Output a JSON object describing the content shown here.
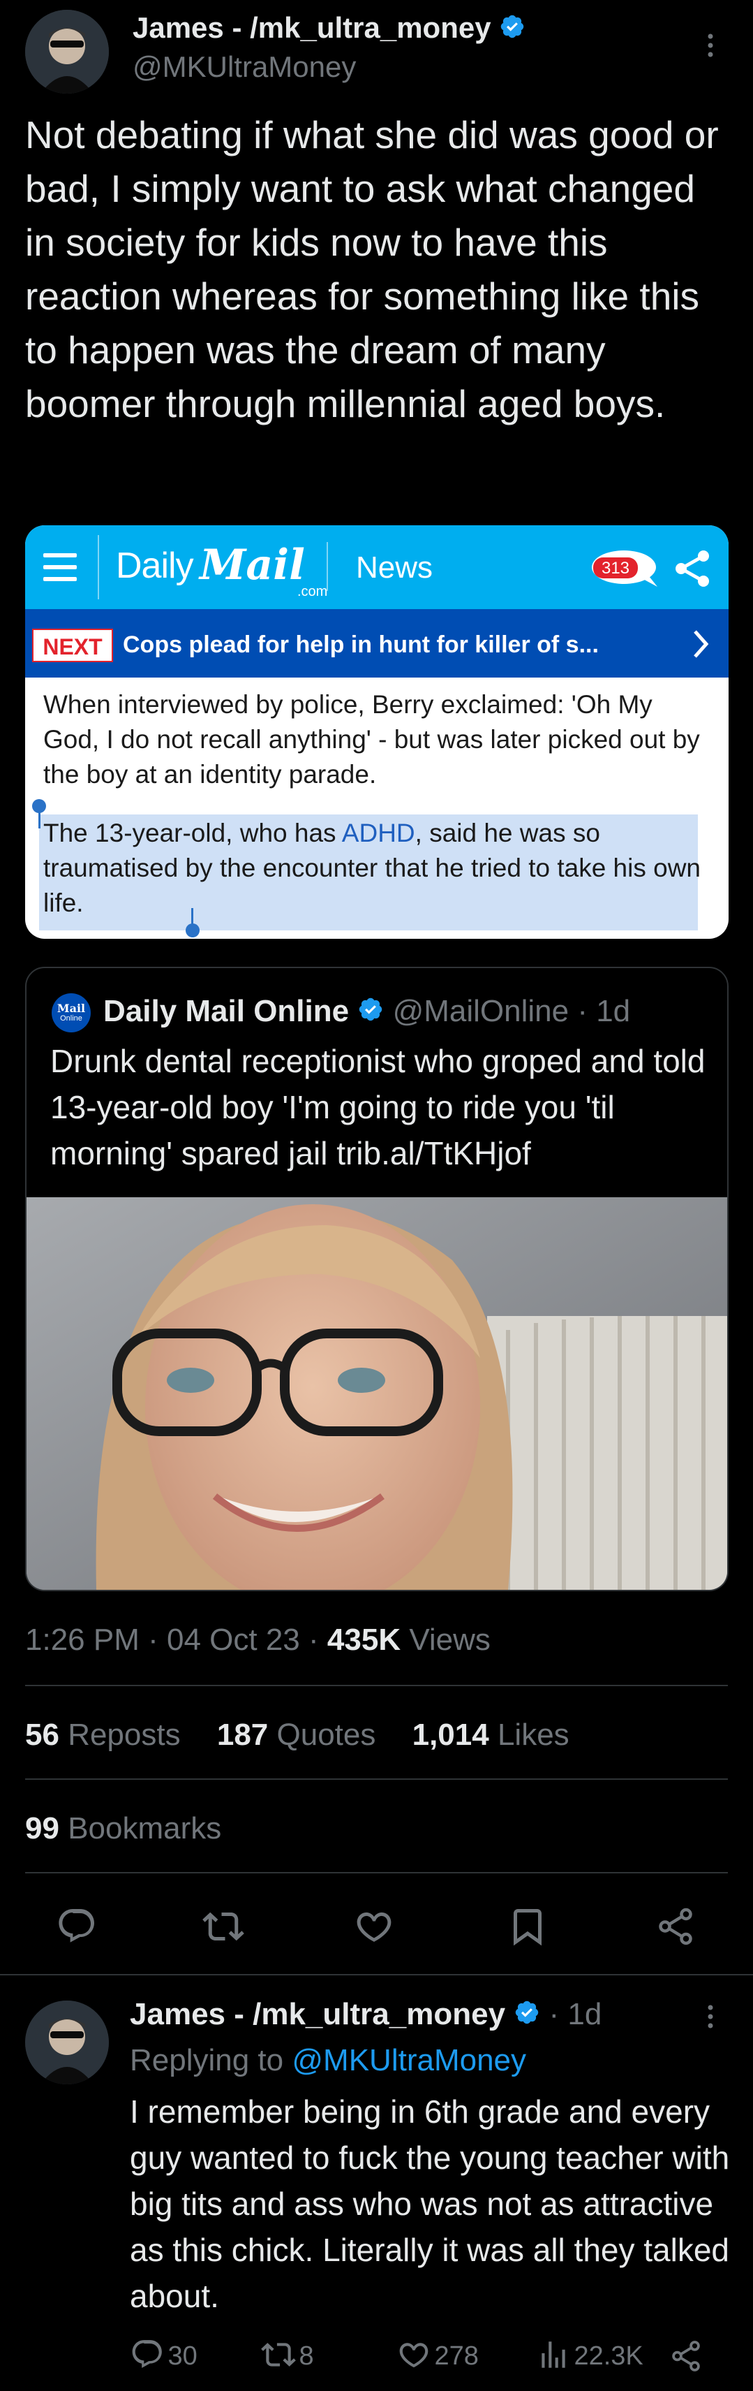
{
  "main_tweet": {
    "author_name": "James - /mk_ultra_money",
    "author_handle": "@MKUltraMoney",
    "text": "Not debating if what she did was good or bad, I simply want to ask what changed in society for kids now to have this reaction whereas for something like this to happen was the dream of many boomer through millennial aged boys."
  },
  "screenshot": {
    "brand_daily": "Daily",
    "brand_mail": "Mail",
    "brand_com": ".com",
    "section": "News",
    "comment_count": "313",
    "next_label": "NEXT",
    "next_headline": "Cops plead for help in hunt for killer of s...",
    "para1": "When interviewed by police, Berry exclaimed: 'Oh My God, I do not recall anything' - but was later picked out by the boy at an identity parade.",
    "para2_a": "The 13-year-old, who has ",
    "para2_link": "ADHD",
    "para2_b": ", said he was so traumatised by the encounter that he tried to take his own life."
  },
  "quoted": {
    "avatar_text_1": "Mail",
    "avatar_text_2": "Online",
    "author_name": "Daily Mail Online",
    "author_handle": "@MailOnline",
    "time": "· 1d",
    "text": "Drunk dental receptionist who groped and told 13-year-old boy 'I'm going to ride you 'til morning' spared jail trib.al/TtKHjof"
  },
  "meta": {
    "time": "1:26 PM",
    "sep1": "·",
    "date": "04 Oct 23",
    "sep2": "·",
    "views_count": "435K",
    "views_label": "Views"
  },
  "stats": {
    "reposts_count": "56",
    "reposts_label": "Reposts",
    "quotes_count": "187",
    "quotes_label": "Quotes",
    "likes_count": "1,014",
    "likes_label": "Likes",
    "bookmarks_count": "99",
    "bookmarks_label": "Bookmarks"
  },
  "reply": {
    "author_name": "James - /mk_ultra_money",
    "time": "· 1d",
    "replying_to_label": "Replying to",
    "replying_to_handle": "@MKUltraMoney",
    "text": "I remember being in 6th grade and every guy wanted to fuck the young teacher with big tits and ass who was not as attractive as this chick. Literally it was all they talked about.",
    "replies": "30",
    "reposts": "8",
    "likes": "278",
    "views": "22.3K"
  },
  "colors": {
    "background": "#000000",
    "text": "#e7e9ea",
    "muted": "#71767b",
    "accent": "#1d9bf0",
    "dailymail_blue": "#00aeef",
    "next_bar": "#004db3",
    "badge_red": "#e3232c",
    "highlight": "#cfe0f6"
  }
}
